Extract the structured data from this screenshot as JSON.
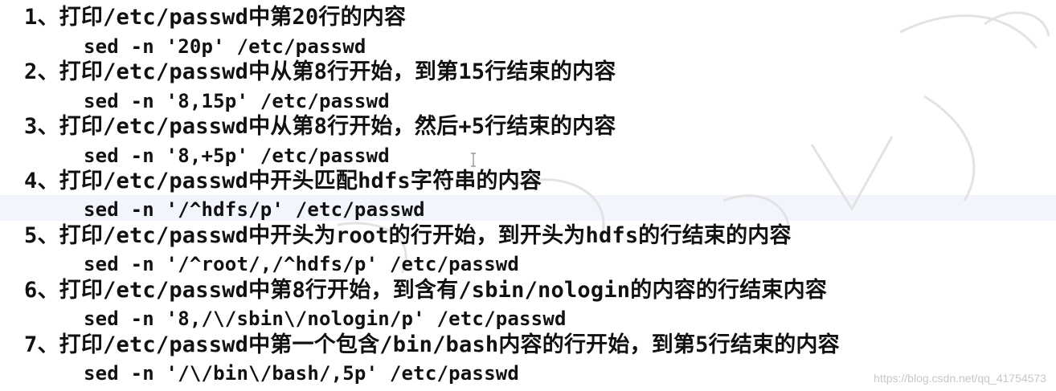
{
  "items": [
    {
      "question": "1、打印/etc/passwd中第20行的内容",
      "command": "sed -n '20p' /etc/passwd"
    },
    {
      "question": "2、打印/etc/passwd中从第8行开始，到第15行结束的内容",
      "command": "sed -n '8,15p' /etc/passwd"
    },
    {
      "question": "3、打印/etc/passwd中从第8行开始，然后+5行结束的内容",
      "command": "sed -n '8,+5p' /etc/passwd"
    },
    {
      "question": "4、打印/etc/passwd中开头匹配hdfs字符串的内容",
      "command": "sed -n '/^hdfs/p' /etc/passwd"
    },
    {
      "question": "5、打印/etc/passwd中开头为root的行开始，到开头为hdfs的行结束的内容",
      "command": "sed -n '/^root/,/^hdfs/p' /etc/passwd"
    },
    {
      "question": "6、打印/etc/passwd中第8行开始，到含有/sbin/nologin的内容的行结束内容",
      "command": "sed -n '8,/\\/sbin\\/nologin/p' /etc/passwd"
    },
    {
      "question": "7、打印/etc/passwd中第一个包含/bin/bash内容的行开始，到第5行结束的内容",
      "command": "sed -n '/\\/bin\\/bash/,5p' /etc/passwd"
    }
  ],
  "watermark": "https://blog.csdn.net/qq_41754573",
  "colors": {
    "text": "#111111",
    "highlight": "#f2f5fb",
    "watermark": "#c7c7c7"
  }
}
